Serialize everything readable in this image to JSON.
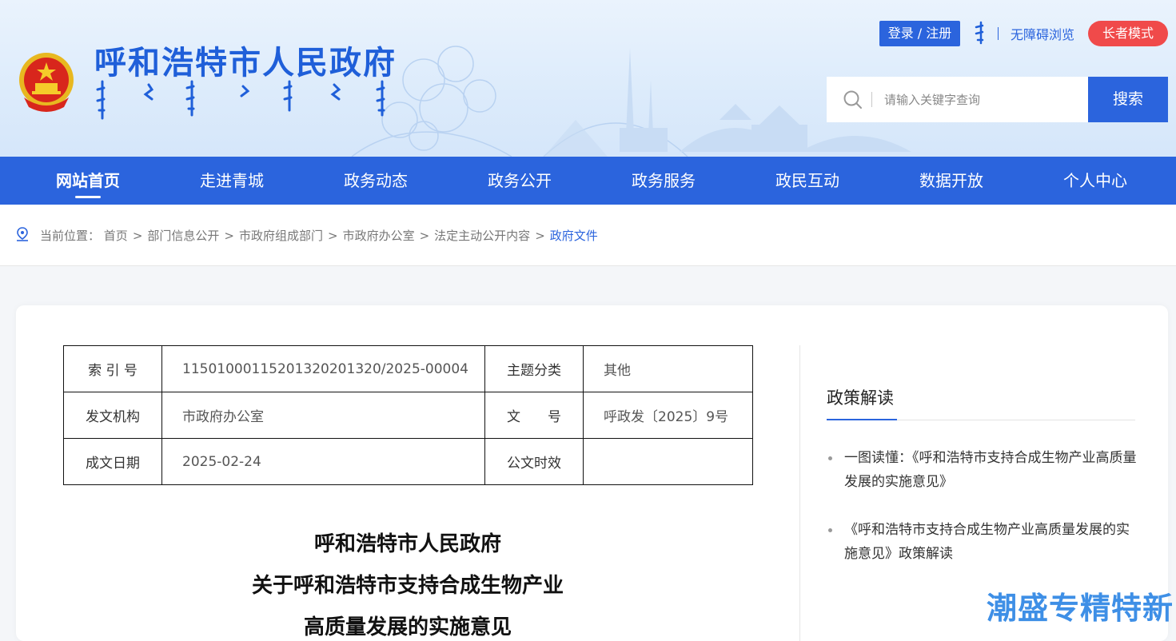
{
  "header": {
    "site_title": "呼和浩特市人民政府",
    "login_label": "登录 / 注册",
    "accessibility_label": "无障碍浏览",
    "elder_mode_label": "长者模式",
    "search_placeholder": "请输入关键字查询",
    "search_button": "搜索"
  },
  "nav": {
    "items": [
      "网站首页",
      "走进青城",
      "政务动态",
      "政务公开",
      "政务服务",
      "政民互动",
      "数据开放",
      "个人中心"
    ],
    "active_index": 0
  },
  "breadcrumb": {
    "prefix": "当前位置：",
    "items": [
      "首页",
      "部门信息公开",
      "市政府组成部门",
      "市政府办公室",
      "法定主动公开内容",
      "政府文件"
    ]
  },
  "meta": {
    "index_label": "索 引 号",
    "index_value": "11501000115201320201320/2025-00004",
    "topic_label": "主题分类",
    "topic_value": "其他",
    "issuer_label": "发文机构",
    "issuer_value": "市政府办公室",
    "docno_label": "文　　号",
    "docno_value": "呼政发〔2025〕9号",
    "date_label": "成文日期",
    "date_value": "2025-02-24",
    "validity_label": "公文时效",
    "validity_value": ""
  },
  "document": {
    "title_line1": "呼和浩特市人民政府",
    "title_line2": "关于呼和浩特市支持合成生物产业",
    "title_line3": "高质量发展的实施意见"
  },
  "side": {
    "title": "政策解读",
    "items": [
      "一图读懂：《呼和浩特市支持合成生物产业高质量发展的实施意见》",
      "《呼和浩特市支持合成生物产业高质量发展的实施意见》政策解读"
    ]
  },
  "watermark": "潮盛专精特新",
  "colors": {
    "brand_blue": "#2b64dd",
    "elder_red": "#f04a4a",
    "title_blue": "#1f5fd9"
  }
}
